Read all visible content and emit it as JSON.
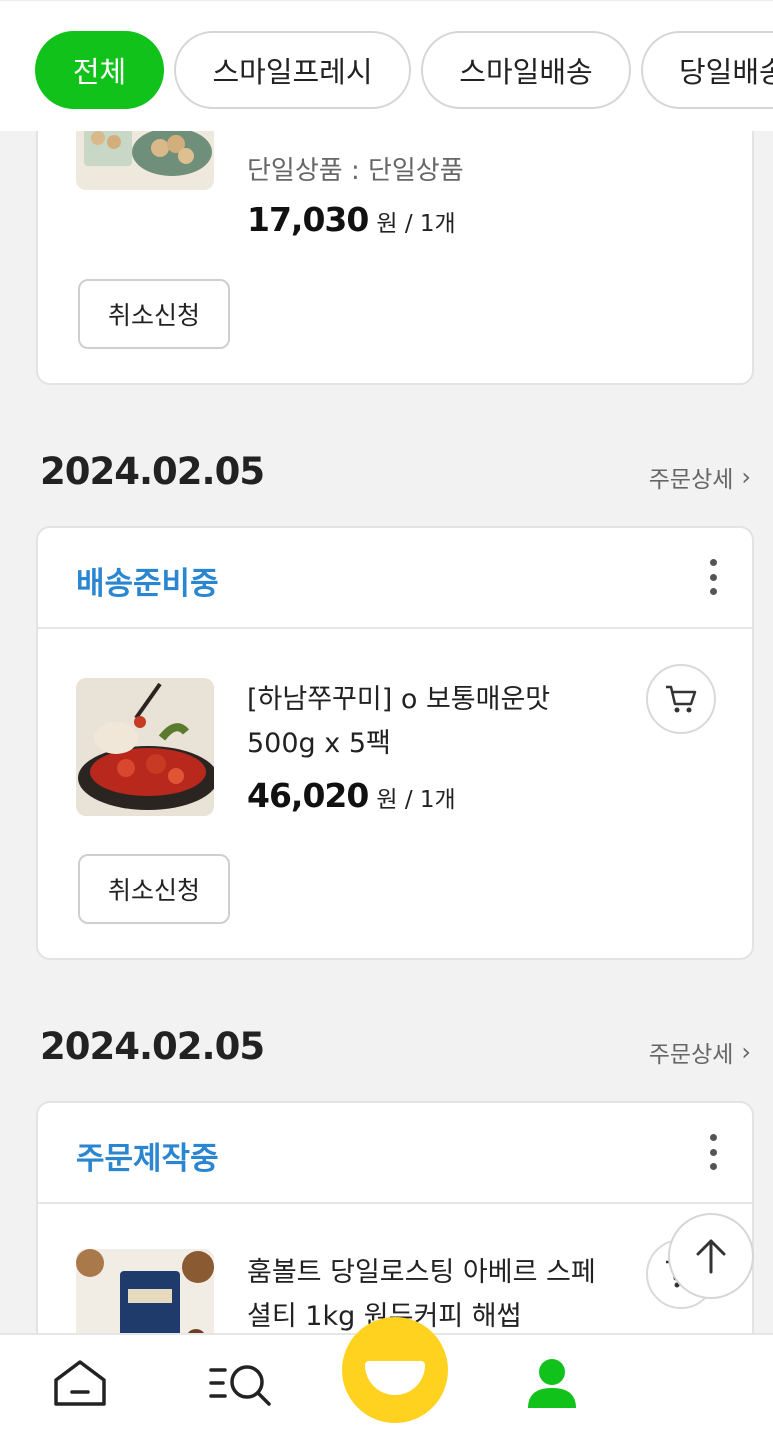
{
  "filters": {
    "chips": [
      {
        "label": "전체",
        "active": true
      },
      {
        "label": "스마일프레시",
        "active": false
      },
      {
        "label": "스마일배송",
        "active": false
      },
      {
        "label": "당일배송",
        "active": false
      }
    ]
  },
  "orders": [
    {
      "option": "단일상품 : 단일상품",
      "price": "17,030",
      "unit": "원 / 1개",
      "cancel_label": "취소신청"
    },
    {
      "date": "2024.02.05",
      "detail_label": "주문상세",
      "status": "배송준비중",
      "name": "[하남쭈꾸미] o 보통매운맛 500g x 5팩",
      "price": "46,020",
      "unit": "원 / 1개",
      "cancel_label": "취소신청"
    },
    {
      "date": "2024.02.05",
      "detail_label": "주문상세",
      "status": "주문제작중",
      "name": "훔볼트 당일로스팅 아베르 스페셜티 1kg 원두커피 해썹"
    }
  ],
  "colors": {
    "accent_green": "#10c21a",
    "status_blue": "#2a86d1",
    "smile_yellow": "#ffd21f"
  },
  "bottom_nav": {
    "items": [
      {
        "icon": "home-icon"
      },
      {
        "icon": "category-search-icon"
      },
      {
        "icon": "smile-face-icon"
      },
      {
        "icon": "my-account-icon",
        "active": true
      },
      {
        "icon": "recent-product-thumbnail"
      }
    ]
  }
}
